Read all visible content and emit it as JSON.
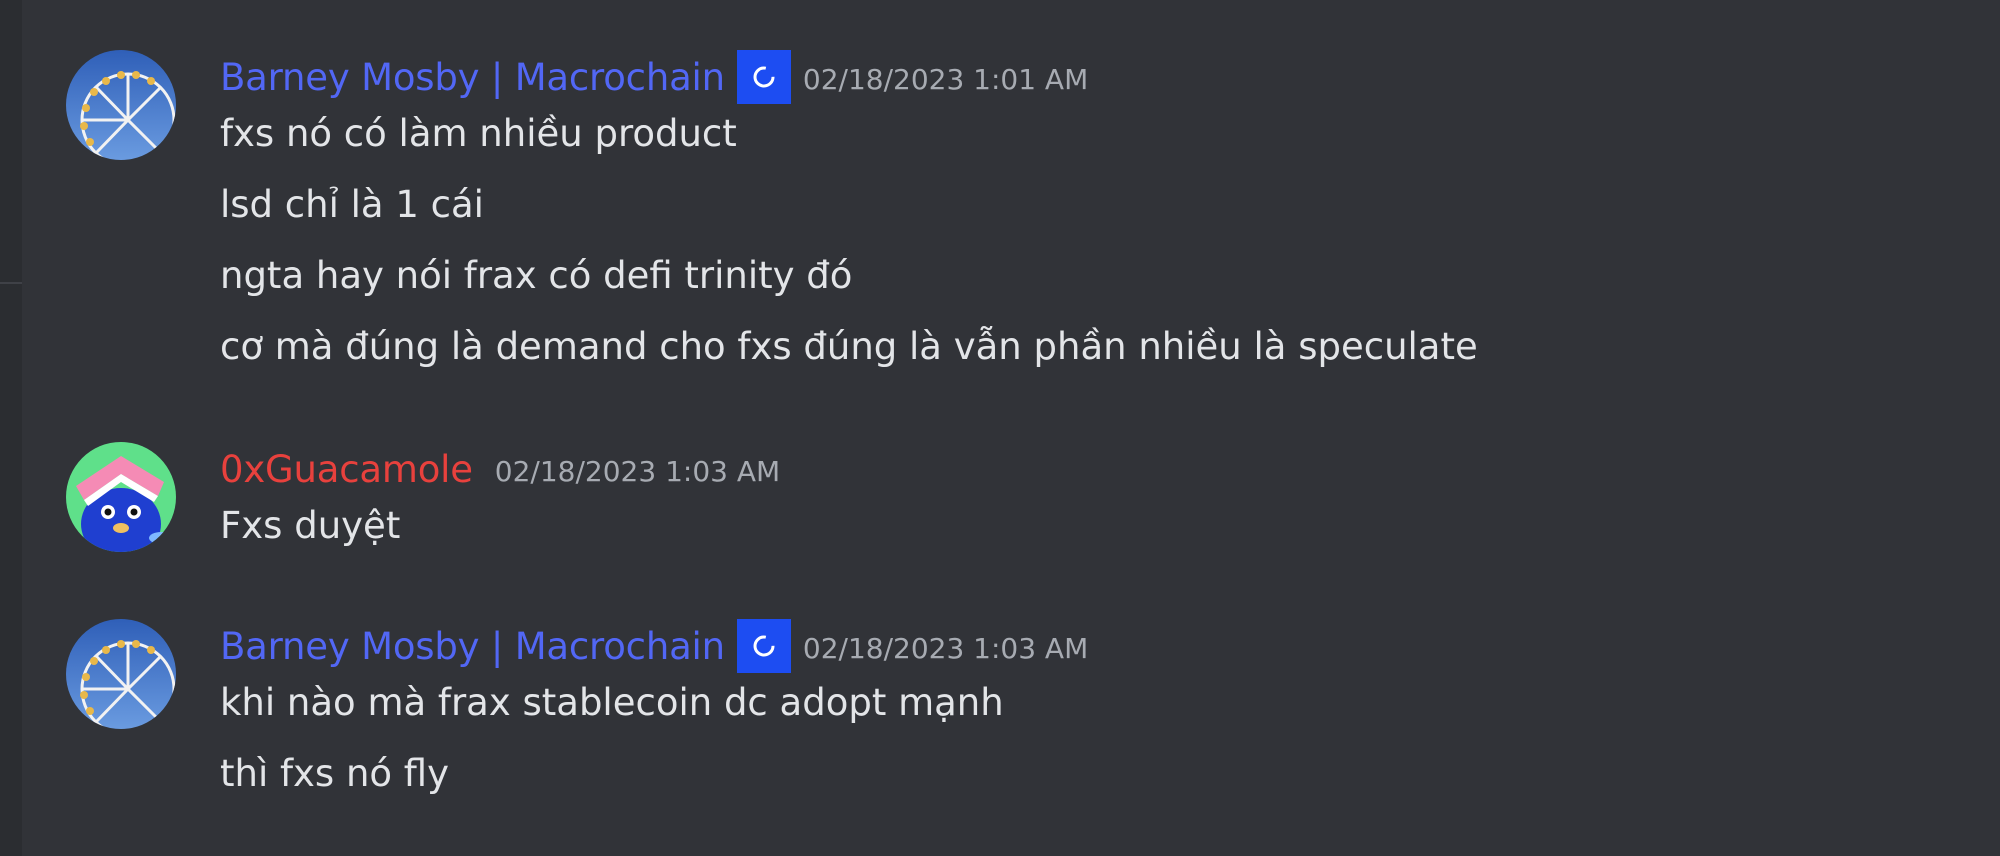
{
  "colors": {
    "background": "#313338",
    "username_blue": "#5267f5",
    "username_red": "#e8413d",
    "badge_blue": "#1d4df2",
    "timestamp": "#a7abb2",
    "message_text": "#e3e5e8"
  },
  "messages": [
    {
      "author": "Barney Mosby | Macrochain",
      "author_color": "#5267f5",
      "badge_icon": "loading-ring-icon",
      "timestamp": "02/18/2023 1:01 AM",
      "avatar_icon": "ferris-wheel-avatar",
      "lines": [
        "fxs nó có làm nhiều product",
        "lsd chỉ là 1 cái",
        "ngta hay nói frax có defi trinity đó",
        "cơ mà đúng là demand cho fxs đúng là vẫn phần nhiều là speculate"
      ]
    },
    {
      "author": "0xGuacamole",
      "author_color": "#e8413d",
      "timestamp": "02/18/2023 1:03 AM",
      "avatar_icon": "blue-creature-avatar",
      "lines": [
        "Fxs duyệt"
      ]
    },
    {
      "author": "Barney Mosby | Macrochain",
      "author_color": "#5267f5",
      "badge_icon": "loading-ring-icon",
      "timestamp": "02/18/2023 1:03 AM",
      "avatar_icon": "ferris-wheel-avatar",
      "lines": [
        "khi nào mà frax stablecoin dc adopt mạnh",
        "thì fxs nó fly"
      ]
    }
  ]
}
